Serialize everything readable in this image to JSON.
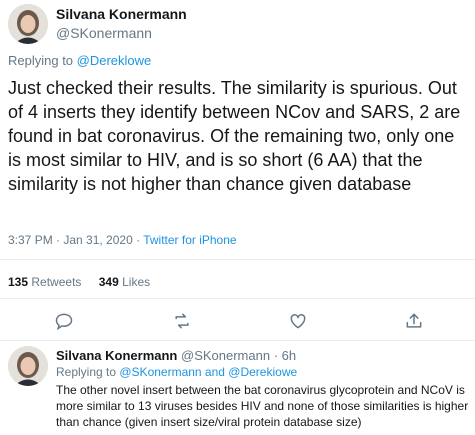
{
  "main_tweet": {
    "author_name": "Silvana Konermann",
    "author_handle": "@SKonermann",
    "replying_prefix": "Replying to ",
    "replying_to": "@Dereklowe",
    "text": "Just checked their results. The similarity is spurious. Out of 4 inserts they identify between NCov and SARS, 2 are found in bat coronavirus. Of the remaining two, only one is most similar to HIV, and is so short (6 AA) that the similarity is not higher than chance given database",
    "timestamp": "3:37 PM · Jan 31, 2020 · ",
    "source": "Twitter for iPhone",
    "retweets_count": "135",
    "retweets_label": "Retweets",
    "likes_count": "349",
    "likes_label": "Likes"
  },
  "action_icons": [
    "reply-icon",
    "retweet-icon",
    "like-icon",
    "share-icon"
  ],
  "reply_tweet": {
    "author_name": "Silvana Konermann",
    "author_handle": "@SKonermann · 6h",
    "replying_prefix": "Replying to ",
    "replying_to": "@SKonermann and @Derekiowe",
    "text": "The other novel insert between the bat coronavirus glycoprotein and NCoV is more similar to 13 viruses besides HIV and none of those similarities is higher than chance (given insert size/viral protein database size)"
  },
  "colors": {
    "link": "#1b95e0",
    "muted": "#657786",
    "divider": "#e6ecf0",
    "text": "#14171a"
  }
}
